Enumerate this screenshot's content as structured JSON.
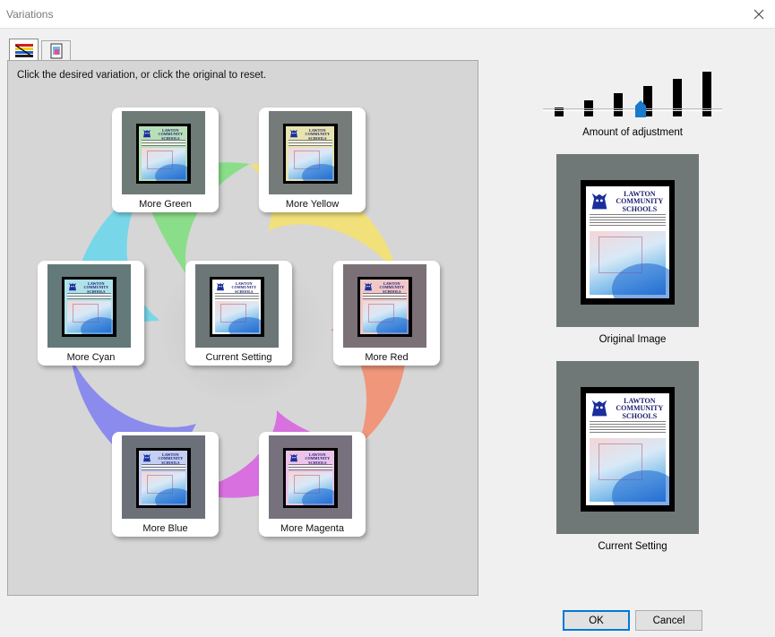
{
  "window": {
    "title": "Variations"
  },
  "tabs": [
    {
      "icon": "color-bars-icon",
      "active": true
    },
    {
      "icon": "image-adjust-icon",
      "active": false
    }
  ],
  "variations": {
    "instruction": "Click the desired variation, or click the original to reset.",
    "items": [
      {
        "key": "more-green",
        "label": "More Green",
        "frame_color": "#6e7b76",
        "tint": "#b8e0b8"
      },
      {
        "key": "more-yellow",
        "label": "More Yellow",
        "frame_color": "#757b78",
        "tint": "#e8e4b0"
      },
      {
        "key": "more-cyan",
        "label": "More Cyan",
        "frame_color": "#63797a",
        "tint": "#b0e2ea"
      },
      {
        "key": "current-setting",
        "label": "Current Setting",
        "frame_color": "#6c7676",
        "tint": "#ffffff"
      },
      {
        "key": "more-red",
        "label": "More Red",
        "frame_color": "#7a7076",
        "tint": "#f0c8c8"
      },
      {
        "key": "more-blue",
        "label": "More Blue",
        "frame_color": "#6b7079",
        "tint": "#c4cff2"
      },
      {
        "key": "more-magenta",
        "label": "More Magenta",
        "frame_color": "#76717c",
        "tint": "#ecc4ea"
      }
    ]
  },
  "thumbnail_text": {
    "line1": "LAWTON",
    "line2": "COMMUNITY",
    "line3": "SCHOOLS"
  },
  "adjustment": {
    "label": "Amount of adjustment",
    "levels": 6,
    "selected_level": 3
  },
  "original": {
    "label": "Original Image",
    "frame_color": "#6f7777"
  },
  "current": {
    "label": "Current Setting",
    "frame_color": "#6f7777"
  },
  "buttons": {
    "ok": "OK",
    "cancel": "Cancel"
  },
  "colors": {
    "accent": "#0078d7",
    "slider_knob": "#1979ca"
  }
}
